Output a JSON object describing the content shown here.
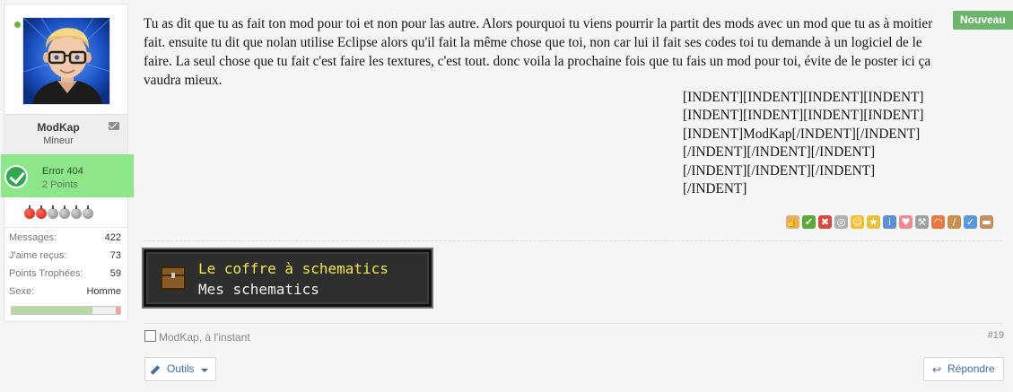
{
  "user": {
    "username": "ModKap",
    "title": "Mineur",
    "online": true
  },
  "trophy": {
    "name": "Error 404",
    "points": "2 Points"
  },
  "rating": {
    "filled": 2,
    "total": 6
  },
  "stats": [
    {
      "label": "Messages:",
      "value": "422"
    },
    {
      "label": "J'aime reçus:",
      "value": "73"
    },
    {
      "label": "Points Trophées:",
      "value": "59"
    },
    {
      "label": "Sexe:",
      "value": "Homme"
    }
  ],
  "gender_bar": {
    "male_fraction": 0.74,
    "female_fraction": 0.04
  },
  "post": {
    "text": "Tu as dit que tu as fait ton mod pour toi et non pour las autre. Alors pourquoi tu viens pourrir la partit des mods avec un mod que tu as à moitier fait. ensuite tu dit que nolan utilise Eclipse alors qu'il fait la même chose que toi, non car lui il fait ses codes toi tu demande à un logiciel de le faire. La seul chose que tu fait c'est faire les textures, c'est tout. donc voila la prochaine fois que tu fais un mod pour toi, évite de le poster ici ça vaudra mieux.",
    "indent_lines": [
      "[INDENT][INDENT][INDENT][INDENT]",
      "[INDENT][INDENT][INDENT][INDENT]",
      "[INDENT]ModKap[/INDENT][/INDENT]",
      "[/INDENT][/INDENT][/INDENT]",
      "[/INDENT][/INDENT][/INDENT]",
      "[/INDENT]"
    ],
    "badge": "Nouveau"
  },
  "reactions": [
    {
      "icon": "thumbs-up-icon",
      "glyph": "👍",
      "color": "#e0b070"
    },
    {
      "icon": "check-icon",
      "glyph": "✔",
      "color": "#5aaa3a"
    },
    {
      "icon": "cross-icon",
      "glyph": "✖",
      "color": "#d84a3a"
    },
    {
      "icon": "facepalm-icon",
      "glyph": "◎",
      "color": "#b0b0b0"
    },
    {
      "icon": "laugh-icon",
      "glyph": "☺",
      "color": "#f0c030"
    },
    {
      "icon": "medal-icon",
      "glyph": "★",
      "color": "#e8c040"
    },
    {
      "icon": "info-icon",
      "glyph": "i",
      "color": "#5b8fd8"
    },
    {
      "icon": "heart-icon",
      "glyph": "♥",
      "color": "#f08a90"
    },
    {
      "icon": "wrench-icon",
      "glyph": "⚒",
      "color": "#a0a0a0"
    },
    {
      "icon": "rainbow-icon",
      "glyph": "◠",
      "color": "#e87840"
    },
    {
      "icon": "brush-icon",
      "glyph": "/",
      "color": "#c89050"
    },
    {
      "icon": "spelling-icon",
      "glyph": "✓",
      "color": "#5a9ad8"
    },
    {
      "icon": "box-icon",
      "glyph": "▬",
      "color": "#c09060"
    }
  ],
  "signature": {
    "line1": "Le coffre à schematics",
    "line2": "Mes schematics"
  },
  "meta": {
    "author": "ModKap, à l'instant",
    "post_number": "#19"
  },
  "buttons": {
    "tools": "Outils",
    "reply": "Répondre"
  }
}
